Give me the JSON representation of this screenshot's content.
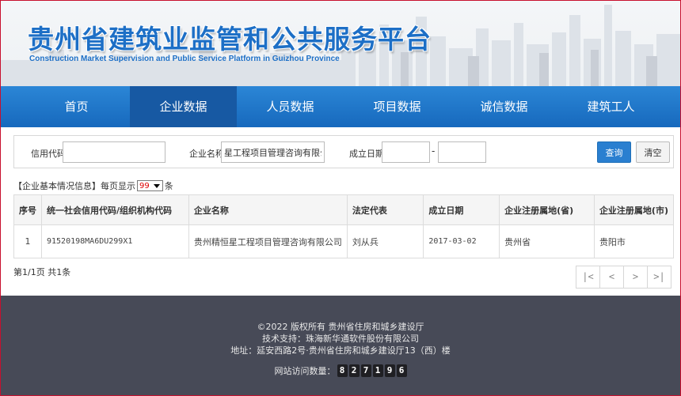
{
  "header": {
    "title": "贵州省建筑业监管和公共服务平台",
    "subtitle": "Construction Market Supervision and Public Service Platform in Guizhou Province"
  },
  "nav": {
    "items": [
      {
        "label": "首页"
      },
      {
        "label": "企业数据"
      },
      {
        "label": "人员数据"
      },
      {
        "label": "项目数据"
      },
      {
        "label": "诚信数据"
      },
      {
        "label": "建筑工人"
      }
    ],
    "active_index": 1
  },
  "search": {
    "credit_code_label": "信用代码",
    "credit_code_value": "",
    "company_name_label": "企业名称",
    "company_name_value": "星工程项目管理咨询有限公司",
    "established_label": "成立日期",
    "date_from": "",
    "date_separator": "-",
    "date_to": "",
    "query_button": "查询",
    "clear_button": "清空"
  },
  "info": {
    "section_title": "【企业基本情况信息】",
    "per_page_prefix": "每页显示",
    "per_page_value": "99",
    "per_page_suffix": "条"
  },
  "table": {
    "headers": [
      "序号",
      "统一社会信用代码/组织机构代码",
      "企业名称",
      "法定代表",
      "成立日期",
      "企业注册属地(省)",
      "企业注册属地(市)"
    ],
    "rows": [
      [
        "1",
        "91520198MA6DU299X1",
        "贵州精恒星工程项目管理咨询有限公司",
        "刘从兵",
        "2017-03-02",
        "贵州省",
        "贵阳市"
      ]
    ]
  },
  "pagination": {
    "summary": "第1/1页 共1条",
    "first": "|<",
    "prev": "<",
    "next": ">",
    "last": ">|"
  },
  "footer": {
    "copyright": "©2022 版权所有 贵州省住房和城乡建设厅",
    "support": "技术支持：珠海新华通软件股份有限公司",
    "address": "地址：延安西路2号·贵州省住房和城乡建设厅13（西）楼",
    "visits_label": "网站访问数量：",
    "visits_digits": [
      "8",
      "2",
      "7",
      "1",
      "9",
      "6"
    ]
  },
  "colors": {
    "brand_blue": "#1d6fc6",
    "nav_blue": "#1769bd",
    "nav_active": "#1759a3",
    "footer_bg": "#474a57",
    "border_red": "#c8102e"
  }
}
